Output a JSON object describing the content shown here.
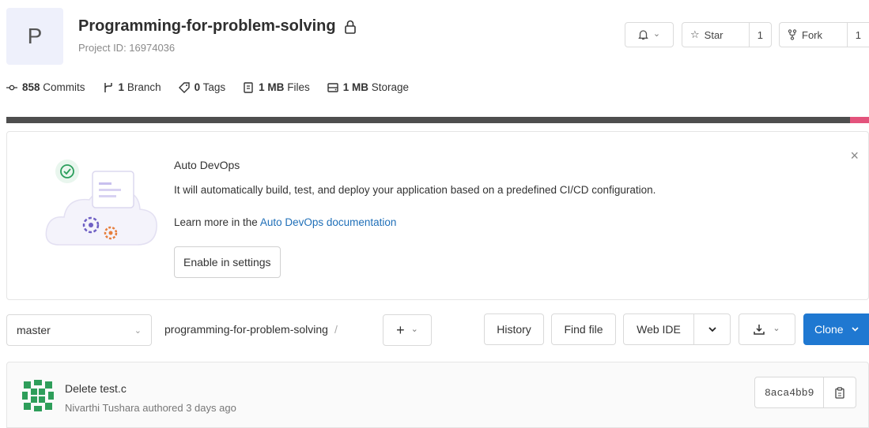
{
  "project": {
    "avatar_letter": "P",
    "name": "Programming-for-problem-solving",
    "id_label": "Project ID: 16974036"
  },
  "header_buttons": {
    "notification_chevron": "⌄",
    "star_label": "Star",
    "star_count": "1",
    "fork_label": "Fork",
    "fork_count": "1"
  },
  "stats": [
    {
      "value": "858",
      "label": "Commits",
      "icon": "commit-icon"
    },
    {
      "value": "1",
      "label": "Branch",
      "icon": "branch-icon"
    },
    {
      "value": "0",
      "label": "Tags",
      "icon": "tag-icon"
    },
    {
      "value": "1 MB",
      "label": "Files",
      "icon": "file-icon"
    },
    {
      "value": "1 MB",
      "label": "Storage",
      "icon": "storage-icon"
    }
  ],
  "language_colors": {
    "primary": "#4e4e4e",
    "secondary": "#e3537c"
  },
  "auto_devops": {
    "title": "Auto DevOps",
    "description": "It will automatically build, test, and deploy your application based on a predefined CI/CD configuration.",
    "learn_prefix": "Learn more in the ",
    "learn_link": "Auto DevOps documentation",
    "enable_button": "Enable in settings",
    "close": "×"
  },
  "repo_toolbar": {
    "branch": "master",
    "path": "programming-for-problem-solving",
    "path_sep": "/",
    "plus": "+",
    "history": "History",
    "find_file": "Find file",
    "web_ide": "Web IDE",
    "clone": "Clone"
  },
  "last_commit": {
    "message": "Delete test.c",
    "author": "Nivarthi Tushara authored 3 days ago",
    "sha": "8aca4bb9"
  },
  "colors": {
    "clone_blue": "#1f78d1",
    "link_blue": "#1f6fb8"
  }
}
